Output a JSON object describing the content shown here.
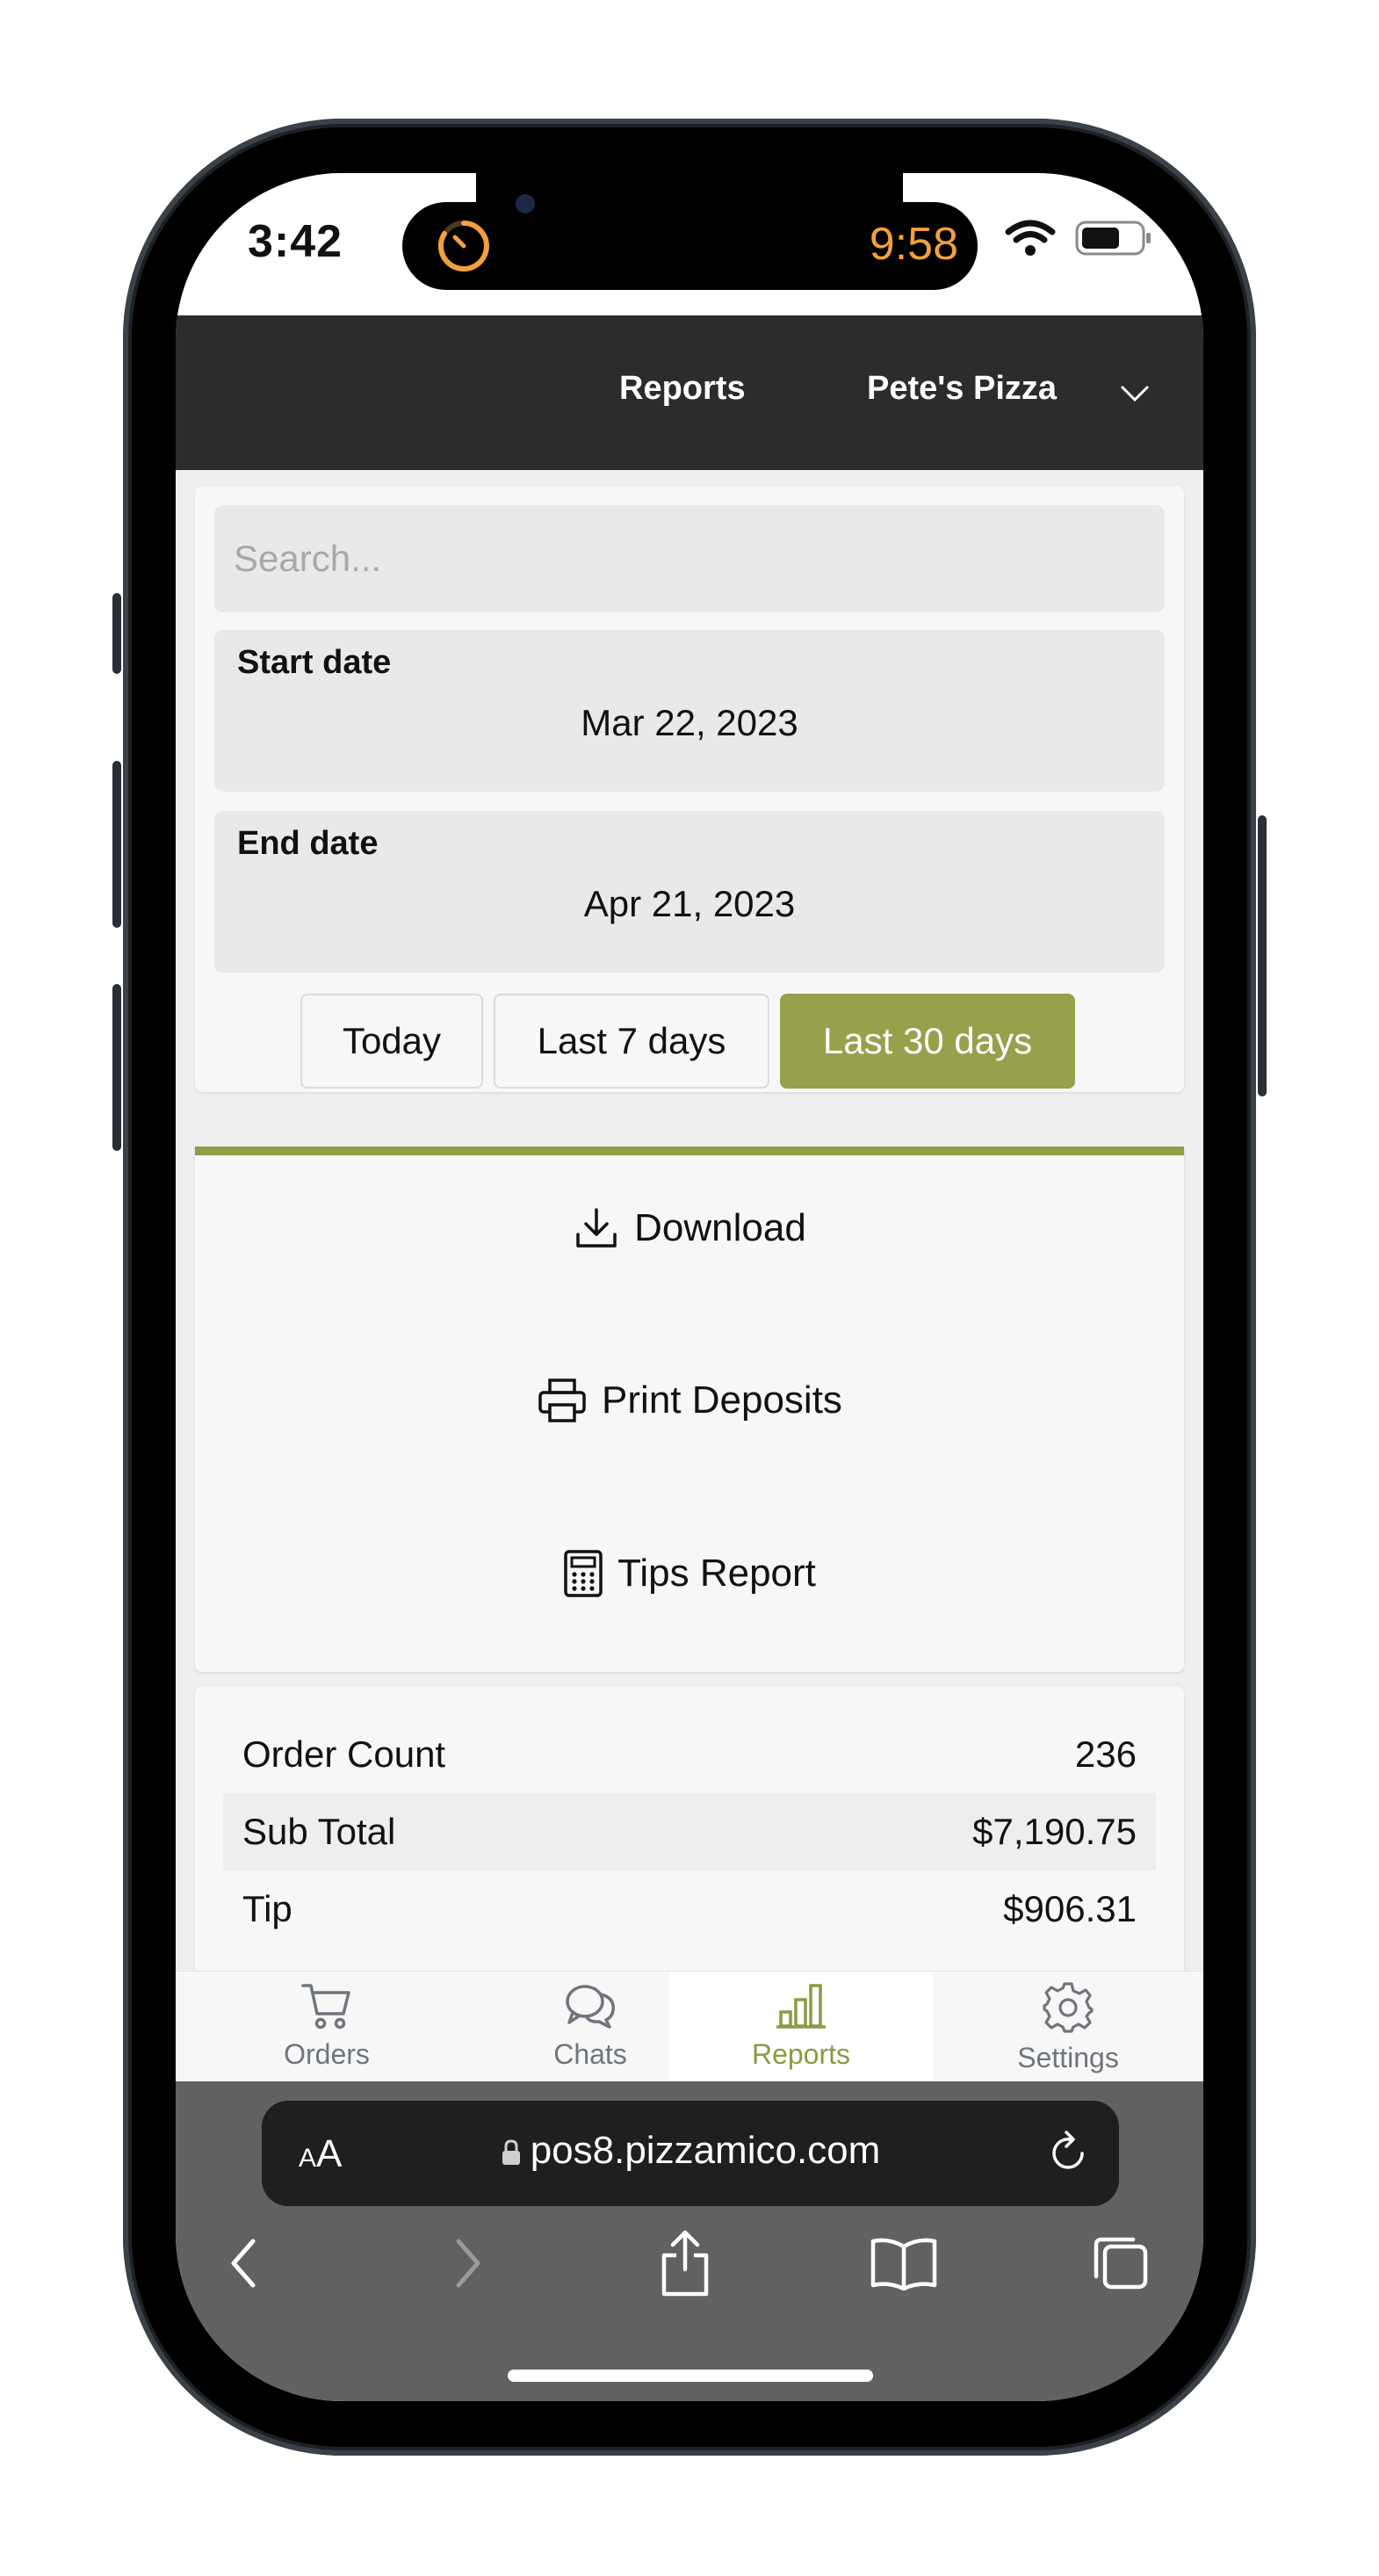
{
  "status_bar": {
    "time": "3:42",
    "timer": "9:58"
  },
  "nav": {
    "reports_label": "Reports",
    "store_name": "Pete's Pizza"
  },
  "filters": {
    "search_placeholder": "Search...",
    "start_date_label": "Start date",
    "start_date_value": "Mar 22, 2023",
    "end_date_label": "End date",
    "end_date_value": "Apr 21, 2023",
    "ranges": [
      "Today",
      "Last 7 days",
      "Last 30 days"
    ],
    "active_range": "Last 30 days"
  },
  "actions": {
    "download": "Download",
    "print_deposits": "Print Deposits",
    "tips_report": "Tips Report"
  },
  "summary": {
    "rows": [
      {
        "label": "Order Count",
        "value": "236"
      },
      {
        "label": "Sub Total",
        "value": "$7,190.75"
      },
      {
        "label": "Tip",
        "value": "$906.31"
      }
    ]
  },
  "tabs": [
    {
      "label": "Orders",
      "icon": "cart-icon"
    },
    {
      "label": "Chats",
      "icon": "chat-icon"
    },
    {
      "label": "Reports",
      "icon": "bar-chart-icon"
    },
    {
      "label": "Settings",
      "icon": "gear-icon"
    }
  ],
  "active_tab": "Reports",
  "browser": {
    "url": "pos8.pizzamico.com",
    "text_size_label_small": "A",
    "text_size_label_large": "A"
  },
  "colors": {
    "accent": "#97a04b",
    "nav_bg": "#2c2c2c",
    "timer": "#f2a13a"
  }
}
